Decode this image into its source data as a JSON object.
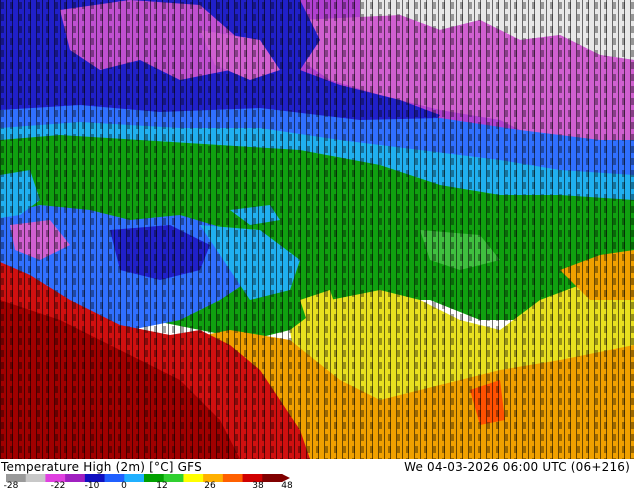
{
  "map": {
    "title": "Temperature High (2m) [°C] GFS",
    "valid_time": "We 04-03-2026 06:00 UTC (06+216)",
    "legend": {
      "ticks": [
        "-28",
        "-22",
        "-10",
        "0",
        "12",
        "26",
        "38",
        "48"
      ],
      "colors": [
        "#9a9a9a",
        "#c8c8c8",
        "#e040e0",
        "#a020c0",
        "#1010c0",
        "#2060ff",
        "#20b0ff",
        "#00a000",
        "#30d030",
        "#ffff00",
        "#ffb000",
        "#ff6000",
        "#d00000",
        "#800000"
      ]
    },
    "region_colors": {
      "very_cold": "#e8e8e8",
      "cold_magenta": "#d060d0",
      "cold_violet": "#b040d0",
      "deep_blue": "#2020c8",
      "blue": "#3070ff",
      "cyan": "#20b0f0",
      "green": "#10a010",
      "yellow": "#e8e020",
      "orange": "#f0a000",
      "red": "#d01010",
      "dark_red": "#a00000"
    }
  }
}
